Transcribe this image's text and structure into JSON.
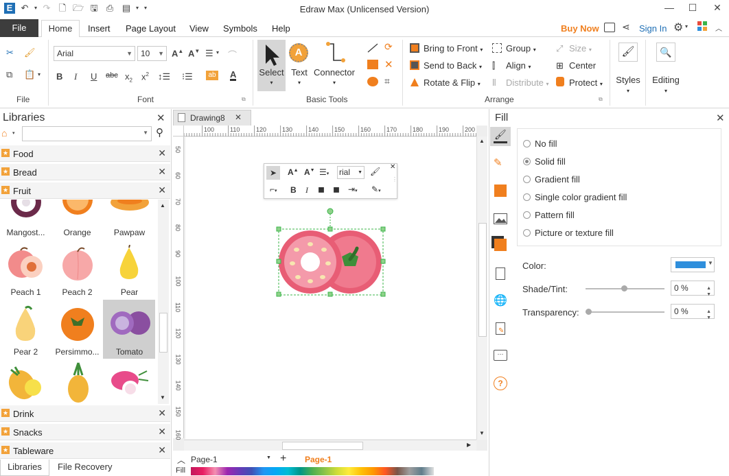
{
  "window": {
    "title": "Edraw Max (Unlicensed Version)"
  },
  "menu": {
    "file": "File",
    "tabs": [
      "Home",
      "Insert",
      "Page Layout",
      "View",
      "Symbols",
      "Help"
    ],
    "buy_now": "Buy Now",
    "sign_in": "Sign In"
  },
  "ribbon": {
    "font": {
      "family": "Arial",
      "size": "10",
      "group_label": "Font"
    },
    "file_group_label": "File",
    "basic_tools": {
      "select": "Select",
      "text": "Text",
      "connector": "Connector",
      "group_label": "Basic Tools"
    },
    "arrange": {
      "bring_to_front": "Bring to Front",
      "send_to_back": "Send to Back",
      "rotate_flip": "Rotate & Flip",
      "group": "Group",
      "align": "Align",
      "distribute": "Distribute",
      "size": "Size",
      "center": "Center",
      "protect": "Protect",
      "group_label": "Arrange"
    },
    "styles": "Styles",
    "editing": "Editing"
  },
  "libraries": {
    "title": "Libraries",
    "search_placeholder": "",
    "sections_top": [
      "Food",
      "Bread",
      "Fruit"
    ],
    "shapes": [
      {
        "label": "Mangost..."
      },
      {
        "label": "Orange"
      },
      {
        "label": "Pawpaw"
      },
      {
        "label": "Peach 1"
      },
      {
        "label": "Peach 2"
      },
      {
        "label": "Pear"
      },
      {
        "label": "Pear 2"
      },
      {
        "label": "Persimmo..."
      },
      {
        "label": "Tomato"
      },
      {
        "label": ""
      },
      {
        "label": ""
      },
      {
        "label": ""
      }
    ],
    "sections_bottom": [
      "Drink",
      "Snacks",
      "Tableware"
    ],
    "bottom_tabs": [
      "Libraries",
      "File Recovery"
    ]
  },
  "document": {
    "tab": "Drawing8",
    "ruler_h": [
      "100",
      "110",
      "120",
      "130",
      "140",
      "150",
      "160",
      "170",
      "180",
      "190",
      "200"
    ],
    "ruler_v": [
      "50",
      "60",
      "70",
      "80",
      "90",
      "100",
      "110",
      "120",
      "130",
      "140",
      "150",
      "160"
    ],
    "page_selector": "Page-1",
    "active_page": "Page-1",
    "fill_label": "Fill"
  },
  "floating_toolbar": {
    "font": "rial"
  },
  "fill_panel": {
    "title": "Fill",
    "options": [
      {
        "label": "No fill",
        "selected": false
      },
      {
        "label": "Solid fill",
        "selected": true
      },
      {
        "label": "Gradient fill",
        "selected": false
      },
      {
        "label": "Single color gradient fill",
        "selected": false
      },
      {
        "label": "Pattern fill",
        "selected": false
      },
      {
        "label": "Picture or texture fill",
        "selected": false
      }
    ],
    "color_label": "Color:",
    "color_value": "#2f8fdc",
    "shade_label": "Shade/Tint:",
    "shade_value": "0 %",
    "transparency_label": "Transparency:",
    "transparency_value": "0 %"
  },
  "colors": {
    "accent_orange": "#f07f1e",
    "file_tab": "#3d3d3d",
    "tomato": "#e85d75",
    "selection": "#3bb54a"
  }
}
